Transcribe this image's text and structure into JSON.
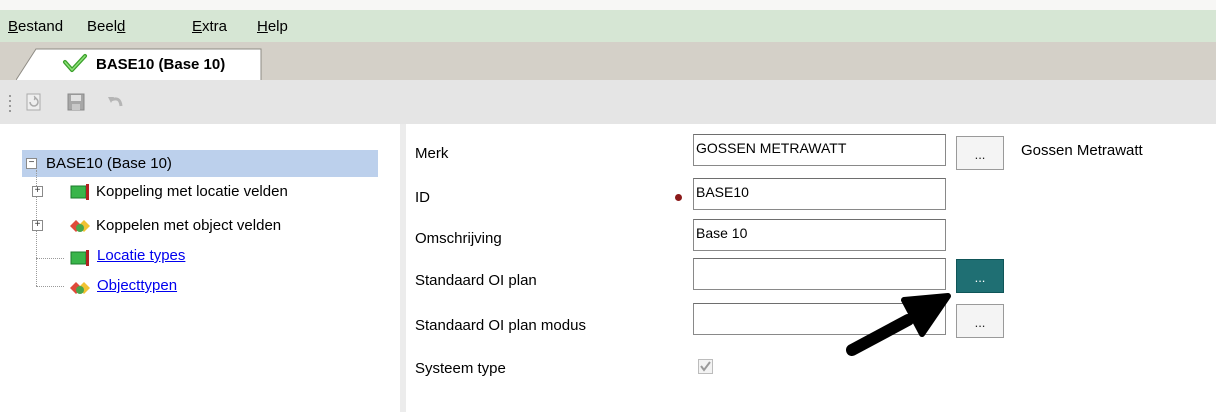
{
  "menu": {
    "items": [
      {
        "label": "Bestand",
        "accel": "B",
        "rest": "estand"
      },
      {
        "label": "Beeld",
        "accel_before": "Beel",
        "accel": "d",
        "rest": ""
      },
      {
        "label": "Extra",
        "accel": "E",
        "rest": "xtra"
      },
      {
        "label": "Help",
        "accel": "H",
        "rest": "elp"
      }
    ]
  },
  "tab": {
    "label": "BASE10 (Base 10)",
    "icon": "green-check-icon"
  },
  "toolbar": {
    "icons": [
      "refresh-icon",
      "save-icon",
      "undo-icon"
    ]
  },
  "tree": {
    "root": "BASE10 (Base 10)",
    "children": [
      {
        "label": "Koppeling met locatie velden",
        "icon": "green-flag-icon"
      },
      {
        "label": "Koppelen met object velden",
        "icon": "object-shapes-icon"
      },
      {
        "label": "Locatie types",
        "icon": "green-flag-icon"
      },
      {
        "label": "Objecttypen",
        "icon": "object-shapes-icon"
      }
    ]
  },
  "form": {
    "merk": {
      "label": "Merk",
      "value": "GOSSEN METRAWATT",
      "button": "...",
      "description": "Gossen Metrawatt"
    },
    "id": {
      "label": "ID",
      "value": "BASE10"
    },
    "omschrijving": {
      "label": "Omschrijving",
      "value": "Base 10"
    },
    "standaard_oi_plan": {
      "label": "Standaard OI plan",
      "value": "",
      "button": "..."
    },
    "standaard_oi_plan_modus": {
      "label": "Standaard OI plan modus",
      "value": "",
      "button": "..."
    },
    "systeem_type": {
      "label": "Systeem type",
      "checked": true
    }
  },
  "colors": {
    "menubar": "#d6e6d4",
    "selection": "#bcd0ec",
    "active_button": "#1f6f73",
    "required_dot": "#8b1a1a",
    "link": "#0000ee"
  }
}
